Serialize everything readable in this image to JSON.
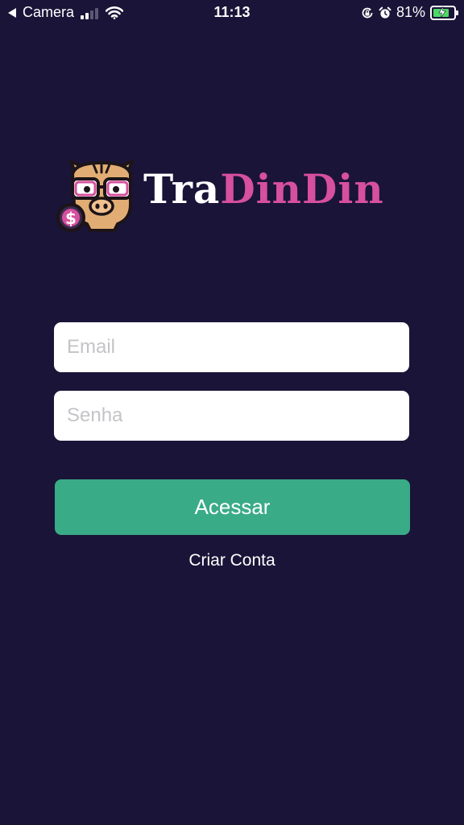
{
  "status_bar": {
    "back_app": "Camera",
    "time": "11:13",
    "battery_percent": "81%",
    "battery_level": 0.81,
    "signal_bars": 2,
    "icons": [
      "back-arrow-icon",
      "cellular-signal-icon",
      "wifi-icon",
      "rotation-lock-icon",
      "alarm-icon",
      "battery-charging-icon"
    ]
  },
  "logo": {
    "text_white": "Tra",
    "text_pink": "DinDin",
    "mascot": "pig-with-glasses-and-dollar-coin",
    "colors": {
      "pink": "#d6509e",
      "white": "#ffffff"
    }
  },
  "form": {
    "email_placeholder": "Email",
    "password_placeholder": "Senha",
    "submit_label": "Acessar",
    "create_account_label": "Criar Conta"
  },
  "theme": {
    "background": "#1a1438",
    "button": "#3aab87"
  }
}
